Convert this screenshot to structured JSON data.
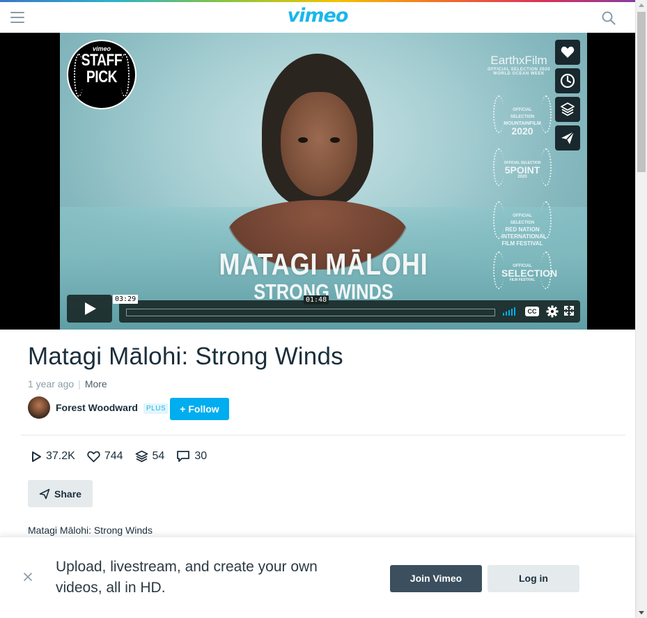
{
  "header": {
    "logo": "vimeo",
    "menu_icon": "hamburger-icon",
    "search_icon": "search-icon"
  },
  "player": {
    "badge": {
      "brand": "vimeo",
      "line1": "STAFF",
      "line2": "PICK"
    },
    "poster_title": "MATAGI MĀLOHI",
    "poster_subtitle": "STRONG WINDS",
    "festivals": [
      {
        "name": "EarthxFilm",
        "sub": "OFFICIAL SELECTION 2020",
        "sub2": "WORLD OCEAN WEEK"
      },
      {
        "line1": "OFFICIAL SELECTION",
        "line2": "MOUNTAINFILM",
        "line3": "2020"
      },
      {
        "line1": "OFFICIAL SELECTION",
        "line2": "5POINT",
        "line3": "2020"
      },
      {
        "line1": "OFFICIAL SELECTION",
        "line2": "RED NATION INTERNATIONAL FILM FESTIVAL"
      },
      {
        "line1": "OFFICIAL",
        "line2": "SELECTION",
        "line3": "FILM FESTIVAL"
      }
    ],
    "side_buttons": [
      "heart-icon",
      "clock-icon",
      "layers-icon",
      "paper-plane-icon"
    ],
    "duration": "03:29",
    "hover_time": "01:48",
    "progress_fraction": 0,
    "volume_level": 1.0,
    "cc_label": "CC",
    "accent": "#00adef"
  },
  "video": {
    "title": "Matagi Mālohi: Strong Winds",
    "age": "1 year ago",
    "separator": "|",
    "more": "More",
    "owner": "Forest Woodward",
    "owner_badge": "PLUS",
    "follow": "+ Follow",
    "stats": {
      "plays": "37.2K",
      "likes": "744",
      "collections": "54",
      "comments": "30"
    },
    "share": "Share",
    "description": "Matagi Mālohi: Strong Winds"
  },
  "banner": {
    "message": "Upload, livestream, and create your own videos, all in HD.",
    "join": "Join Vimeo",
    "login": "Log in"
  }
}
